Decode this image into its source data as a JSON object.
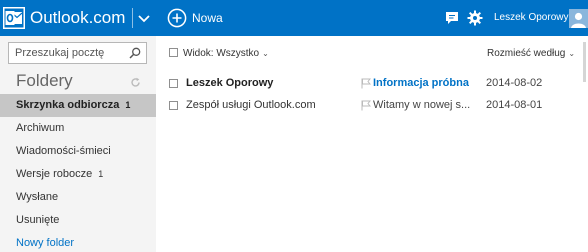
{
  "header": {
    "brand": "Outlook.com",
    "new_label": "Nowa",
    "user_name": "Leszek Oporowy"
  },
  "sidebar": {
    "search_placeholder": "Przeszukaj pocztę",
    "folders_title": "Foldery",
    "folders": [
      {
        "label": "Skrzynka odbiorcza",
        "count": "1",
        "selected": true
      },
      {
        "label": "Archiwum",
        "count": ""
      },
      {
        "label": "Wiadomości-śmieci",
        "count": ""
      },
      {
        "label": "Wersje robocze",
        "count": "1"
      },
      {
        "label": "Wysłane",
        "count": ""
      },
      {
        "label": "Usunięte",
        "count": ""
      }
    ],
    "new_folder": "Nowy folder"
  },
  "toolbar": {
    "view_label": "Widok: Wszystko",
    "sort_label": "Rozmieść według"
  },
  "messages": [
    {
      "sender": "Leszek Oporowy",
      "subject": "Informacja próbna",
      "date": "2014-08-02",
      "unread": true
    },
    {
      "sender": "Zespół usługi Outlook.com",
      "subject": "Witamy w nowej s...",
      "date": "2014-08-01",
      "unread": false
    }
  ],
  "colors": {
    "accent": "#0072c6",
    "sidebar_bg": "#f4f4f4",
    "selected_bg": "#c6c6c6"
  },
  "icons": [
    "outlook-logo-icon",
    "chevron-down-icon",
    "plus-circle-icon",
    "chat-icon",
    "gear-icon",
    "search-icon",
    "refresh-icon",
    "flag-icon"
  ]
}
